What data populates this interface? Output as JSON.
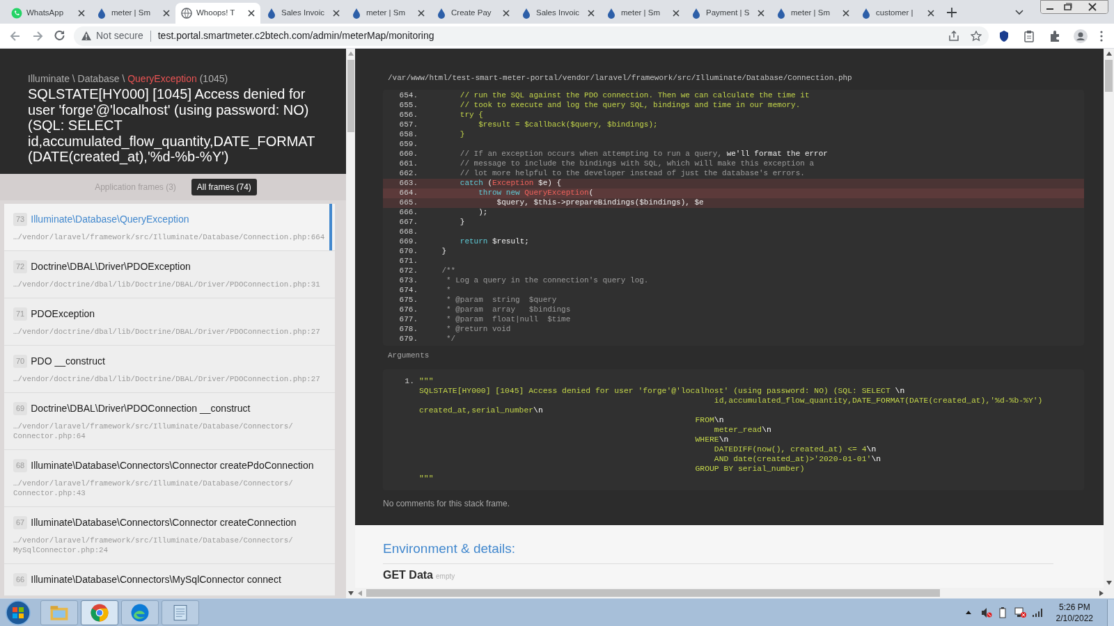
{
  "browser": {
    "tabs": [
      {
        "title": "WhatsApp",
        "kind": "whatsapp",
        "selected": false
      },
      {
        "title": "meter | Sm",
        "kind": "drop",
        "selected": false
      },
      {
        "title": "Whoops! T",
        "kind": "globe",
        "selected": true
      },
      {
        "title": "Sales Invoic",
        "kind": "drop",
        "selected": false
      },
      {
        "title": "meter | Sm",
        "kind": "drop",
        "selected": false
      },
      {
        "title": "Create Pay",
        "kind": "drop",
        "selected": false
      },
      {
        "title": "Sales Invoic",
        "kind": "drop",
        "selected": false
      },
      {
        "title": "meter | Sm",
        "kind": "drop",
        "selected": false
      },
      {
        "title": "Payment | S",
        "kind": "drop",
        "selected": false
      },
      {
        "title": "meter | Sm",
        "kind": "drop",
        "selected": false
      },
      {
        "title": "customer |",
        "kind": "drop",
        "selected": false
      }
    ],
    "address": {
      "security": "Not secure",
      "url": "test.portal.smartmeter.c2btech.com/admin/meterMap/monitoring"
    }
  },
  "error_header": {
    "namespace": "Illuminate \\ Database \\ ",
    "exception": "QueryException",
    "code": "(1045)",
    "message": "SQLSTATE[HY000] [1045] Access denied for user 'forge'@'localhost' (using password: NO) (SQL: SELECT id,accumulated_flow_quantity,DATE_FORMAT(DATE(created_at),'%d-%b-%Y')"
  },
  "frame_filters": [
    {
      "label": "Application frames (3)",
      "selected": false
    },
    {
      "label": "All frames (74)",
      "selected": true
    }
  ],
  "frames": [
    {
      "index": "73",
      "name": "Illuminate\\Database\\QueryException",
      "file": "…/vendor/laravel/framework/src/Illuminate/Database/Connection.php:664",
      "selected": true
    },
    {
      "index": "72",
      "name": "Doctrine\\DBAL\\Driver\\PDOException",
      "file": "…/vendor/doctrine/dbal/lib/Doctrine/DBAL/Driver/PDOConnection.php:31",
      "selected": false
    },
    {
      "index": "71",
      "name": "PDOException",
      "file": "…/vendor/doctrine/dbal/lib/Doctrine/DBAL/Driver/PDOConnection.php:27",
      "selected": false
    },
    {
      "index": "70",
      "name": "PDO __construct",
      "file": "…/vendor/doctrine/dbal/lib/Doctrine/DBAL/Driver/PDOConnection.php:27",
      "selected": false
    },
    {
      "index": "69",
      "name": "Doctrine\\DBAL\\Driver\\PDOConnection __construct",
      "file": "…/vendor/laravel/framework/src/Illuminate/Database/Connectors/Connector.php:64",
      "selected": false
    },
    {
      "index": "68",
      "name": "Illuminate\\Database\\Connectors\\Connector createPdoConnection",
      "file": "…/vendor/laravel/framework/src/Illuminate/Database/Connectors/Connector.php:43",
      "selected": false
    },
    {
      "index": "67",
      "name": "Illuminate\\Database\\Connectors\\Connector createConnection",
      "file": "…/vendor/laravel/framework/src/Illuminate/Database/Connectors/MySqlConnector.php:24",
      "selected": false
    },
    {
      "index": "66",
      "name": "Illuminate\\Database\\Connectors\\MySqlConnector connect",
      "selected": false
    }
  ],
  "code_view": {
    "path": "/var/www/html/test-smart-meter-portal/vendor/laravel/framework/src/Illuminate/Database/Connection.php",
    "lines": [
      {
        "number": "654.",
        "highlighted": false,
        "current": false,
        "segments": [
          {
            "kind": "lime",
            "text": "        // run the SQL against the PDO connection. Then we can calculate the time it"
          }
        ]
      },
      {
        "number": "655.",
        "highlighted": false,
        "current": false,
        "segments": [
          {
            "kind": "lime",
            "text": "        // took to execute and log the query SQL, bindings and time in our memory."
          }
        ]
      },
      {
        "number": "656.",
        "highlighted": false,
        "current": false,
        "segments": [
          {
            "kind": "lime",
            "text": "        try {"
          }
        ]
      },
      {
        "number": "657.",
        "highlighted": false,
        "current": false,
        "segments": [
          {
            "kind": "lime",
            "text": "            $result = $callback($query, $bindings);"
          }
        ]
      },
      {
        "number": "658.",
        "highlighted": false,
        "current": false,
        "segments": [
          {
            "kind": "lime",
            "text": "        }"
          }
        ]
      },
      {
        "number": "659.",
        "highlighted": false,
        "current": false
      },
      {
        "number": "660.",
        "highlighted": false,
        "current": false,
        "segments": [
          {
            "kind": "comment",
            "text": "        // If an exception occurs when attempting to run a query, "
          },
          {
            "kind": "plain",
            "text": "we'll format the error"
          }
        ]
      },
      {
        "number": "661.",
        "highlighted": false,
        "current": false,
        "segments": [
          {
            "kind": "comment",
            "text": "        // message to include the bindings with SQL, which will make this exception a"
          }
        ]
      },
      {
        "number": "662.",
        "highlighted": false,
        "current": false,
        "segments": [
          {
            "kind": "comment",
            "text": "        // lot more helpful to the developer instead of just the database's errors."
          }
        ]
      },
      {
        "number": "663.",
        "highlighted": true,
        "current": false,
        "segments": [
          {
            "kind": "keyword",
            "text": "        catch "
          },
          {
            "kind": "plain",
            "text": "("
          },
          {
            "kind": "type",
            "text": "Exception"
          },
          {
            "kind": "plain",
            "text": " $e) {"
          }
        ]
      },
      {
        "number": "664.",
        "highlighted": true,
        "current": true,
        "segments": [
          {
            "kind": "keyword",
            "text": "            throw new "
          },
          {
            "kind": "type",
            "text": "QueryException"
          },
          {
            "kind": "plain",
            "text": "("
          }
        ]
      },
      {
        "number": "665.",
        "highlighted": true,
        "current": false,
        "segments": [
          {
            "kind": "plain",
            "text": "                $query, $this->prepareBindings($bindings), $e"
          }
        ]
      },
      {
        "number": "666.",
        "highlighted": false,
        "current": false,
        "segments": [
          {
            "kind": "plain",
            "text": "            );"
          }
        ]
      },
      {
        "number": "667.",
        "highlighted": false,
        "current": false,
        "segments": [
          {
            "kind": "plain",
            "text": "        }"
          }
        ]
      },
      {
        "number": "668.",
        "highlighted": false,
        "current": false
      },
      {
        "number": "669.",
        "highlighted": false,
        "current": false,
        "segments": [
          {
            "kind": "keyword",
            "text": "        return"
          },
          {
            "kind": "plain",
            "text": " $result;"
          }
        ]
      },
      {
        "number": "670.",
        "highlighted": false,
        "current": false,
        "segments": [
          {
            "kind": "plain",
            "text": "    }"
          }
        ]
      },
      {
        "number": "671.",
        "highlighted": false,
        "current": false
      },
      {
        "number": "672.",
        "highlighted": false,
        "current": false,
        "segments": [
          {
            "kind": "comment",
            "text": "    /**"
          }
        ]
      },
      {
        "number": "673.",
        "highlighted": false,
        "current": false,
        "segments": [
          {
            "kind": "comment",
            "text": "     * Log a query in the connection's query log."
          }
        ]
      },
      {
        "number": "674.",
        "highlighted": false,
        "current": false,
        "segments": [
          {
            "kind": "comment",
            "text": "     *"
          }
        ]
      },
      {
        "number": "675.",
        "highlighted": false,
        "current": false,
        "segments": [
          {
            "kind": "comment",
            "text": "     * @param  string  $query"
          }
        ]
      },
      {
        "number": "676.",
        "highlighted": false,
        "current": false,
        "segments": [
          {
            "kind": "comment",
            "text": "     * @param  array   $bindings"
          }
        ]
      },
      {
        "number": "677.",
        "highlighted": false,
        "current": false,
        "segments": [
          {
            "kind": "comment",
            "text": "     * @param  float|null  $time"
          }
        ]
      },
      {
        "number": "678.",
        "highlighted": false,
        "current": false,
        "segments": [
          {
            "kind": "comment",
            "text": "     * @return void"
          }
        ]
      },
      {
        "number": "679.",
        "highlighted": false,
        "current": false,
        "segments": [
          {
            "kind": "comment",
            "text": "     */"
          }
        ]
      }
    ]
  },
  "arguments": {
    "label": "Arguments",
    "items": [
      {
        "number": "1.",
        "lines": [
          [
            {
              "kind": "lime",
              "text": "\"\"\""
            }
          ],
          [
            {
              "kind": "lime",
              "text": "SQLSTATE[HY000] [1045] Access denied for user 'forge'@'localhost' (using password: NO) (SQL: SELECT "
            },
            {
              "kind": "escape",
              "text": "\\n"
            }
          ],
          [
            {
              "kind": "lime",
              "text": "                                                              id,accumulated_flow_quantity,DATE_FORMAT(DATE(created_at),'%d-%b-%Y')"
            }
          ],
          [
            {
              "kind": "lime",
              "text": "created_at,serial_number"
            },
            {
              "kind": "escape",
              "text": "\\n"
            }
          ],
          [
            {
              "kind": "lime",
              "text": "                                                          FROM"
            },
            {
              "kind": "escape",
              "text": "\\n"
            }
          ],
          [
            {
              "kind": "lime",
              "text": "                                                              meter_read"
            },
            {
              "kind": "escape",
              "text": "\\n"
            }
          ],
          [
            {
              "kind": "lime",
              "text": "                                                          WHERE"
            },
            {
              "kind": "escape",
              "text": "\\n"
            }
          ],
          [
            {
              "kind": "lime",
              "text": "                                                              DATEDIFF(now(), created_at) <= 4"
            },
            {
              "kind": "escape",
              "text": "\\n"
            }
          ],
          [
            {
              "kind": "lime",
              "text": "                                                              AND date(created_at)>'2020-01-01'"
            },
            {
              "kind": "escape",
              "text": "\\n"
            }
          ],
          [
            {
              "kind": "lime",
              "text": "                                                          GROUP BY serial_number)"
            }
          ],
          [
            {
              "kind": "lime",
              "text": "\"\"\""
            }
          ]
        ]
      }
    ]
  },
  "comments": "No comments for this stack frame.",
  "environment": {
    "title": "Environment & details:",
    "sections": [
      {
        "title": "GET Data",
        "note": "empty"
      }
    ]
  },
  "taskbar": {
    "apps": [
      {
        "kind": "folder",
        "active": false
      },
      {
        "kind": "chrome",
        "active": true
      },
      {
        "kind": "edge",
        "active": false
      },
      {
        "kind": "notepad",
        "active": false
      }
    ],
    "clock": {
      "time": "5:26 PM",
      "date": "2/10/2022"
    }
  }
}
